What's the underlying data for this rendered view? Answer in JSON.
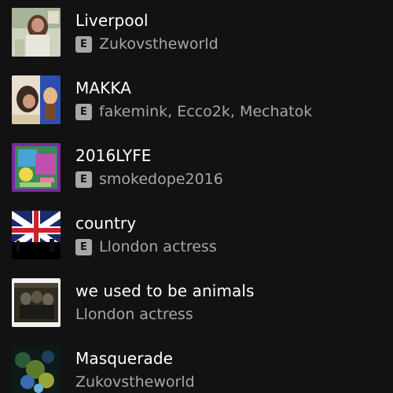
{
  "tracks": [
    {
      "title": "Liverpool",
      "artists": "Zukovstheworld",
      "explicit": true,
      "explicit_label": "E",
      "cover_icon": "liverpool-cover"
    },
    {
      "title": "MAKKA",
      "artists": "fakemink, Ecco2k, Mechatok",
      "explicit": true,
      "explicit_label": "E",
      "cover_icon": "makka-cover"
    },
    {
      "title": "2016LYFE",
      "artists": "smokedope2016",
      "explicit": true,
      "explicit_label": "E",
      "cover_icon": "2016lyfe-cover"
    },
    {
      "title": "country",
      "artists": "Llondon actress",
      "explicit": true,
      "explicit_label": "E",
      "cover_icon": "country-cover"
    },
    {
      "title": "we used to be animals",
      "artists": "Llondon actress",
      "explicit": false,
      "cover_icon": "animals-cover"
    },
    {
      "title": "Masquerade",
      "artists": "Zukovstheworld",
      "explicit": false,
      "cover_icon": "masquerade-cover"
    }
  ],
  "colors": {
    "background": "#121212",
    "title": "#ffffff",
    "subtitle": "#a7a7a7",
    "explicit_badge": "#a7a7a7"
  }
}
